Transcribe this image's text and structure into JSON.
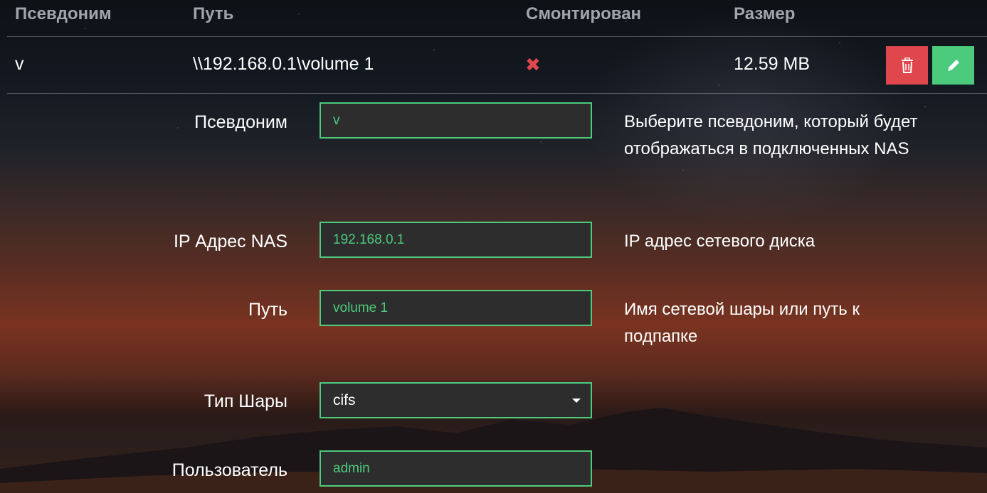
{
  "table": {
    "headers": {
      "alias": "Псевдоним",
      "path": "Путь",
      "mounted": "Смонтирован",
      "size": "Размер"
    },
    "rows": [
      {
        "alias": "v",
        "path": "\\\\192.168.0.1\\volume 1",
        "mounted": false,
        "mounted_icon": "✖",
        "size": "12.59 MB"
      }
    ]
  },
  "actions": {
    "delete_icon": "trash-icon",
    "edit_icon": "pencil-icon"
  },
  "form": {
    "alias": {
      "label": "Псевдоним",
      "value": "v",
      "help": "Выберите псевдоним, который будет отображаться в подключенных NAS"
    },
    "ip": {
      "label": "IP Адрес NAS",
      "value": "192.168.0.1",
      "help": "IP адрес сетевого диска"
    },
    "path": {
      "label": "Путь",
      "value": "volume 1",
      "help": "Имя сетевой шары или путь к подпапке"
    },
    "share_type": {
      "label": "Тип Шары",
      "value": "cifs"
    },
    "user": {
      "label": "Пользователь",
      "value": "admin"
    }
  },
  "colors": {
    "accent": "#4ccb7d",
    "danger": "#e0474c",
    "input_bg": "#2d2d2d"
  }
}
